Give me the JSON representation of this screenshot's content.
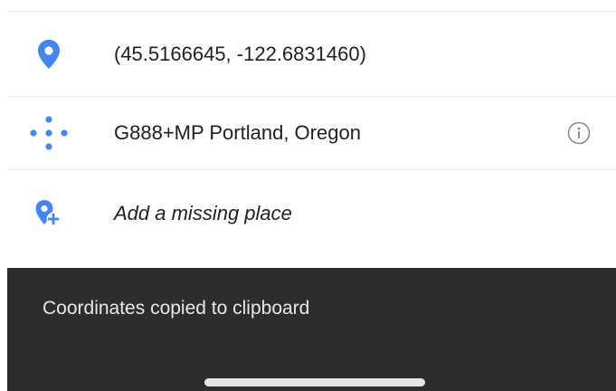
{
  "place_details": {
    "coordinates": {
      "icon": "location-pin-icon",
      "text": "(45.5166645, -122.6831460)"
    },
    "plus_code": {
      "icon": "plus-code-dots-icon",
      "text": "G888+MP Portland, Oregon",
      "info_icon": "info-icon"
    },
    "add_place": {
      "icon": "add-place-pin-icon",
      "text": "Add a missing place"
    }
  },
  "snackbar": {
    "message": "Coordinates copied to clipboard"
  },
  "colors": {
    "accent_blue": "#4285f4",
    "snackbar_bg": "#2d2d2d",
    "text_primary": "#202124",
    "icon_grey": "#8a8a8a"
  }
}
